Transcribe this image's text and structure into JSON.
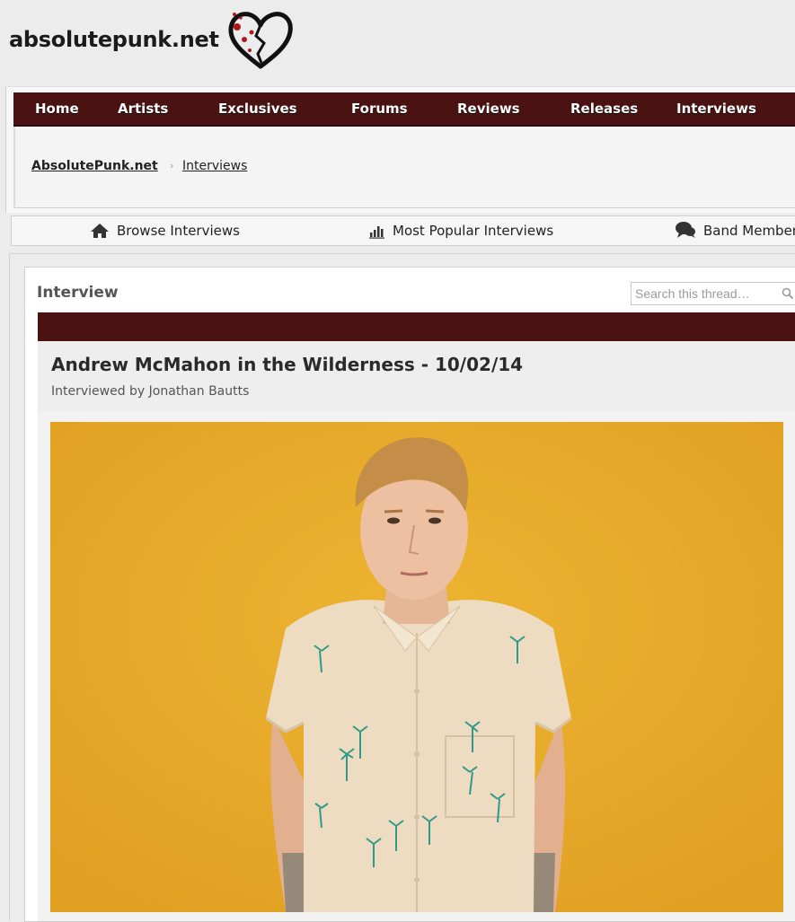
{
  "site": {
    "logo_text": "absolutepunk.net",
    "logo_icon": "broken-heart-icon"
  },
  "nav": {
    "items": [
      {
        "label": "Home"
      },
      {
        "label": "Artists"
      },
      {
        "label": "Exclusives"
      },
      {
        "label": "Forums"
      },
      {
        "label": "Reviews"
      },
      {
        "label": "Releases"
      },
      {
        "label": "Interviews"
      }
    ]
  },
  "breadcrumb": {
    "home": "AbsolutePunk.net",
    "separator": "›",
    "current": "Interviews"
  },
  "subnav": {
    "items": [
      {
        "label": "Browse Interviews",
        "icon": "home-icon"
      },
      {
        "label": "Most Popular Interviews",
        "icon": "bar-chart-icon"
      },
      {
        "label": "Band Member",
        "icon": "chat-bubbles-icon"
      }
    ]
  },
  "section": {
    "title": "Interview"
  },
  "search": {
    "placeholder": "Search this thread…"
  },
  "article": {
    "title": "Andrew McMahon in the Wilderness - 10/02/14",
    "byline": "Interviewed by Jonathan Bautts"
  },
  "colors": {
    "nav_bg": "#4a1312",
    "photo_bg": "#e6a829",
    "shirt": "#eddcc2"
  }
}
